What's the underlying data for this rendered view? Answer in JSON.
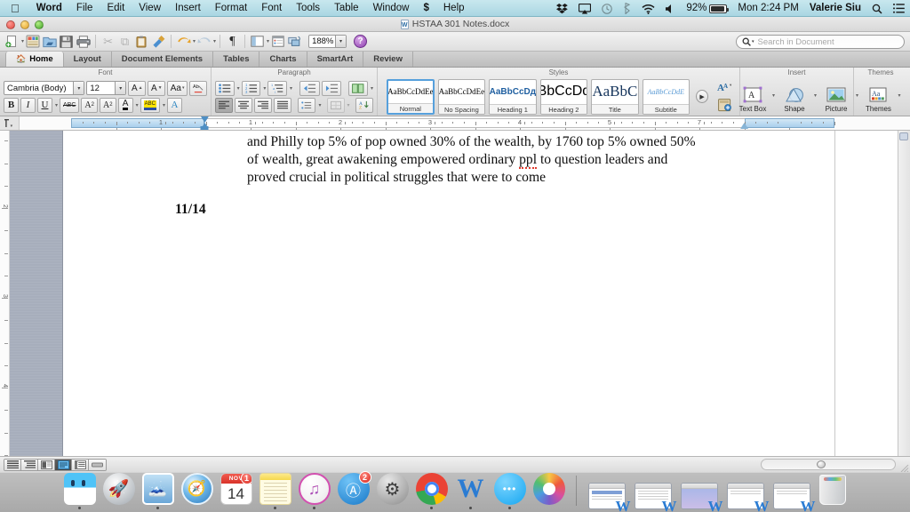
{
  "menubar": {
    "apple_icon": "apple-logo-icon",
    "items": [
      {
        "label": "Word",
        "bold": true
      },
      {
        "label": "File",
        "bold": false
      },
      {
        "label": "Edit",
        "bold": false
      },
      {
        "label": "View",
        "bold": false
      },
      {
        "label": "Insert",
        "bold": false
      },
      {
        "label": "Format",
        "bold": false
      },
      {
        "label": "Font",
        "bold": false
      },
      {
        "label": "Tools",
        "bold": false
      },
      {
        "label": "Table",
        "bold": false
      },
      {
        "label": "Window",
        "bold": false
      },
      {
        "label": "Help",
        "bold": false
      }
    ],
    "status": {
      "dropbox_icon": "dropbox-icon",
      "airplay_icon": "airplay-icon",
      "timemachine_icon": "time-machine-icon",
      "bluetooth_icon": "bluetooth-icon",
      "wifi_icon": "wifi-icon",
      "volume_icon": "volume-icon",
      "battery_percent": "92%",
      "clock": "Mon 2:24 PM",
      "user": "Valerie Siu",
      "spotlight_icon": "search-icon",
      "notification_icon": "notification-center-icon"
    }
  },
  "window": {
    "title": "HSTAA 301 Notes.docx",
    "doc_icon": "word-document-icon"
  },
  "toolbar": {
    "buttons": [
      {
        "name": "new-document-button",
        "glyph": "📄",
        "caret": true,
        "dimmed": false
      },
      {
        "name": "new-from-template-button",
        "glyph": "▦",
        "caret": false,
        "dimmed": false
      },
      {
        "name": "open-button",
        "glyph": "📂",
        "caret": false,
        "dimmed": false
      },
      {
        "name": "save-button",
        "glyph": "💾",
        "caret": false,
        "dimmed": false
      },
      {
        "name": "print-button",
        "glyph": "🖨",
        "caret": false,
        "dimmed": false
      },
      {
        "name": "cut-button",
        "glyph": "✂",
        "caret": false,
        "dimmed": true
      },
      {
        "name": "copy-button",
        "glyph": "⧉",
        "caret": false,
        "dimmed": true
      },
      {
        "name": "paste-button",
        "glyph": "📋",
        "caret": false,
        "dimmed": false
      },
      {
        "name": "format-painter-button",
        "glyph": "🖌",
        "caret": false,
        "dimmed": false
      },
      {
        "name": "undo-button",
        "glyph": "↶",
        "caret": true,
        "dimmed": false
      },
      {
        "name": "redo-button",
        "glyph": "↷",
        "caret": true,
        "dimmed": true
      },
      {
        "name": "show-formatting-marks-button",
        "glyph": "¶",
        "caret": false,
        "dimmed": false
      },
      {
        "name": "sidebar-button",
        "glyph": "▤",
        "caret": true,
        "dimmed": false
      },
      {
        "name": "notebook-layout-button",
        "glyph": "🗒",
        "caret": false,
        "dimmed": false
      },
      {
        "name": "media-browser-button",
        "glyph": "🎛",
        "caret": false,
        "dimmed": false
      }
    ],
    "zoom_value": "188%",
    "help_label": "?",
    "search_placeholder": "Search in Document",
    "search_value": ""
  },
  "ribbon": {
    "tabs": [
      {
        "label": "Home",
        "active": true,
        "icon": "home-icon"
      },
      {
        "label": "Layout",
        "active": false,
        "icon": ""
      },
      {
        "label": "Document Elements",
        "active": false,
        "icon": ""
      },
      {
        "label": "Tables",
        "active": false,
        "icon": ""
      },
      {
        "label": "Charts",
        "active": false,
        "icon": ""
      },
      {
        "label": "SmartArt",
        "active": false,
        "icon": ""
      },
      {
        "label": "Review",
        "active": false,
        "icon": ""
      }
    ],
    "groups": {
      "font": {
        "title": "Font",
        "font_name": "Cambria (Body)",
        "font_size": "12",
        "grow_font": "A",
        "shrink_font": "A",
        "change_case": "Aa",
        "clear_formatting": "Ab",
        "bold": "B",
        "italic": "I",
        "underline": "U",
        "strikethrough": "ABC",
        "superscript": "A2",
        "subscript": "A2",
        "font_color": "A",
        "highlight": "ABC",
        "text_effects": "A"
      },
      "paragraph": {
        "title": "Paragraph",
        "bullets": "•≡",
        "numbering": "1≡",
        "multilevel": "≣",
        "decrease_indent": "⇤",
        "increase_indent": "⇥",
        "columns": "‖",
        "align_left": "≡",
        "align_center": "≡",
        "align_right": "≡",
        "justify": "≡",
        "line_spacing": "↕≡",
        "borders": "⊞",
        "sort": "A↓"
      },
      "styles": {
        "title": "Styles",
        "cards": [
          {
            "preview": "AaBbCcDdEе",
            "label": "Normal",
            "selected": true,
            "style": "serif-normal"
          },
          {
            "preview": "AaBbCcDdEе",
            "label": "No Spacing",
            "selected": false,
            "style": "serif-normal"
          },
          {
            "preview": "AaBbCcDд",
            "label": "Heading 1",
            "selected": false,
            "style": "sans-bold-blue"
          },
          {
            "preview": "AaBbCcDdEе",
            "label": "Heading 2",
            "selected": false,
            "style": "sans-blue"
          },
          {
            "preview": "AaBbC",
            "label": "Title",
            "selected": false,
            "style": "serif-big"
          },
          {
            "preview": "AaBbCcDdE",
            "label": "Subtitle",
            "selected": false,
            "style": "serif-italic-blue"
          }
        ],
        "scroll_arrow": "▶",
        "manage_styles": "Aᴀ",
        "style_pane": "🗂"
      },
      "insert": {
        "title": "Insert",
        "items": [
          {
            "label": "Text Box",
            "icon": "text-box-icon",
            "glyph": "🅰"
          },
          {
            "label": "Shape",
            "icon": "shape-icon",
            "glyph": "◔"
          },
          {
            "label": "Picture",
            "icon": "picture-icon",
            "glyph": "🖼"
          }
        ]
      },
      "themes": {
        "title": "Themes",
        "items": [
          {
            "label": "Themes",
            "icon": "themes-icon",
            "glyph": "Aa"
          }
        ]
      }
    }
  },
  "ruler": {
    "horizontal_numbers": [
      "1",
      "1",
      "2",
      "3",
      "4",
      "5",
      "7"
    ],
    "tab_selector_icon": "tab-stop-selector-icon",
    "left_indent_position": "1 inch",
    "right_indent_position": "6.5 inch",
    "vertical_numbers": [
      "2",
      "3",
      "4"
    ]
  },
  "document": {
    "paragraph": "and Philly top 5% of pop owned 30% of the wealth, by 1760 top 5% owned 50% of wealth, great awakening empowered ordinary ",
    "spellcheck_word": "ppl",
    "paragraph_tail": " to question leaders and proved crucial in political struggles that were to come",
    "date_heading": "11/14"
  },
  "statusbar": {
    "view_buttons": [
      {
        "name": "view-draft",
        "glyph": "≡",
        "active": false
      },
      {
        "name": "view-outline",
        "glyph": "☷",
        "active": false
      },
      {
        "name": "view-publishing-layout",
        "glyph": "▤",
        "active": false
      },
      {
        "name": "view-print-layout",
        "glyph": "☰",
        "active": true
      },
      {
        "name": "view-notebook-layout",
        "glyph": "⌸",
        "active": false
      },
      {
        "name": "view-full-screen",
        "glyph": "▬",
        "active": false
      }
    ]
  },
  "dock": {
    "apps": [
      {
        "name": "finder",
        "label": "Finder",
        "icon": "ic-finder",
        "glyph": "",
        "running": true,
        "badge": ""
      },
      {
        "name": "launchpad",
        "label": "Launchpad",
        "icon": "ic-launch",
        "glyph": "🚀",
        "running": false,
        "badge": ""
      },
      {
        "name": "mail",
        "label": "Mail",
        "icon": "ic-mail",
        "glyph": "🕊",
        "running": true,
        "badge": ""
      },
      {
        "name": "safari",
        "label": "Safari",
        "icon": "ic-safari",
        "glyph": "🧭",
        "running": false,
        "badge": ""
      },
      {
        "name": "calendar",
        "label": "Calendar",
        "icon": "ic-cal",
        "glyph": "",
        "running": false,
        "badge": "1",
        "month": "NOV",
        "day": "14"
      },
      {
        "name": "notes",
        "label": "Notes",
        "icon": "ic-notes",
        "glyph": "",
        "running": true,
        "badge": ""
      },
      {
        "name": "itunes",
        "label": "iTunes",
        "icon": "ic-itunes",
        "glyph": "♫",
        "running": true,
        "badge": ""
      },
      {
        "name": "app-store",
        "label": "App Store",
        "icon": "ic-appstore",
        "glyph": "A",
        "running": false,
        "badge": "2"
      },
      {
        "name": "system-preferences",
        "label": "System Preferences",
        "icon": "ic-prefs",
        "glyph": "⚙",
        "running": false,
        "badge": ""
      },
      {
        "name": "chrome",
        "label": "Google Chrome",
        "icon": "ic-chrome",
        "glyph": "",
        "running": true,
        "badge": ""
      },
      {
        "name": "word",
        "label": "Microsoft Word",
        "icon": "ic-word",
        "glyph": "W",
        "running": true,
        "badge": ""
      },
      {
        "name": "messages",
        "label": "Messages",
        "icon": "ic-msg",
        "glyph": "",
        "running": true,
        "badge": ""
      },
      {
        "name": "photos",
        "label": "Photos",
        "icon": "ic-photos",
        "glyph": "",
        "running": false,
        "badge": ""
      }
    ],
    "minimized_windows": [
      {
        "name": "minimized-word-1",
        "variant": "lines"
      },
      {
        "name": "minimized-word-2",
        "variant": "lines"
      },
      {
        "name": "minimized-word-3",
        "variant": "blue"
      },
      {
        "name": "minimized-word-4",
        "variant": "lines"
      },
      {
        "name": "minimized-word-5",
        "variant": "lines"
      }
    ],
    "trash": {
      "name": "trash",
      "label": "Trash"
    }
  },
  "colors": {
    "menubar": "#b9dfe8",
    "accent_blue": "#4f8fc4",
    "word_blue": "#2b7cd3",
    "spell_red": "#e23b2e",
    "selected_view": "#6fc2f5"
  }
}
